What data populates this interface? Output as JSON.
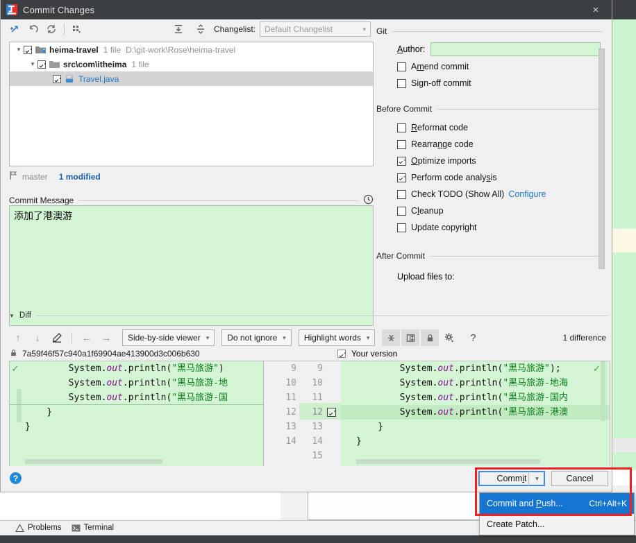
{
  "window": {
    "title": "Commit Changes",
    "app_icon": "intellij-idea-icon",
    "close_label": "×"
  },
  "changes_toolbar": {
    "buttons": [
      {
        "name": "show-diff-icon",
        "glyph": "↗"
      },
      {
        "name": "revert-icon",
        "glyph": "↺"
      },
      {
        "name": "refresh-icon",
        "glyph": "⟳"
      },
      {
        "name": "group-by-icon",
        "glyph": "∷"
      },
      {
        "name": "expand-all-icon",
        "glyph": "⤓"
      },
      {
        "name": "collapse-all-icon",
        "glyph": "⤒"
      }
    ],
    "changelist_label": "Changelist:",
    "changelist_mnemonic": "t",
    "changelist_value": "Default Changelist"
  },
  "tree": {
    "nodes": [
      {
        "label": "heima-travel",
        "meta": "1 file",
        "path": "D:\\git-work\\Rose\\heima-travel",
        "checked": true,
        "expanded": true,
        "icon": "module-folder-icon",
        "depth": 0,
        "selected": false,
        "type": "folder"
      },
      {
        "label": "src\\com\\itheima",
        "meta": "1 file",
        "path": "",
        "checked": true,
        "expanded": true,
        "icon": "folder-icon",
        "depth": 1,
        "selected": false,
        "type": "folder"
      },
      {
        "label": "Travel.java",
        "meta": "",
        "path": "",
        "checked": true,
        "expanded": null,
        "icon": "java-file-icon",
        "depth": 2,
        "selected": true,
        "type": "file"
      }
    ]
  },
  "branch_bar": {
    "icon": "branch-icon",
    "branch": "master",
    "modified": "1 modified"
  },
  "commit_message": {
    "title": "Commit Message",
    "title_mnemonic": "C",
    "history_icon": "clock-icon",
    "value": "添加了港澳游"
  },
  "git_panel": {
    "group_git": "Git",
    "author_label": "Author:",
    "author_mnemonic": "A",
    "author_value": "",
    "amend": {
      "label": "Amend commit",
      "mnemonic": "m",
      "checked": false
    },
    "signoff": {
      "label": "Sign-off commit",
      "mnemonic": "g",
      "checked": false
    },
    "group_before": "Before Commit",
    "before_items": [
      {
        "label": "Reformat code",
        "mnemonic": "R",
        "checked": false,
        "link": ""
      },
      {
        "label": "Rearrange code",
        "mnemonic": "n",
        "checked": false,
        "link": ""
      },
      {
        "label": "Optimize imports",
        "mnemonic": "O",
        "checked": true,
        "link": ""
      },
      {
        "label": "Perform code analysis",
        "mnemonic": "s",
        "checked": true,
        "link": ""
      },
      {
        "label": "Check TODO (Show All)",
        "mnemonic": "",
        "checked": false,
        "link": "Configure"
      },
      {
        "label": "Cleanup",
        "mnemonic": "l",
        "checked": false,
        "link": ""
      },
      {
        "label": "Update copyright",
        "mnemonic": "",
        "checked": false,
        "link": ""
      }
    ],
    "group_after": "After Commit",
    "upload_label": "Upload files to:"
  },
  "diff": {
    "section_title": "Diff",
    "nav_icons": [
      {
        "name": "previous-difference-icon",
        "glyph": "↑"
      },
      {
        "name": "next-difference-icon",
        "glyph": "↓"
      },
      {
        "name": "edit-source-icon",
        "glyph": "✎"
      },
      {
        "name": "previous-file-icon",
        "glyph": "←"
      },
      {
        "name": "next-file-icon",
        "glyph": "→"
      }
    ],
    "viewer_mode": "Side-by-side viewer",
    "ignore_mode": "Do not ignore",
    "highlight_mode": "Highlight words",
    "toggle_icons": [
      {
        "name": "collapse-unchanged-icon",
        "glyph": "⤓"
      },
      {
        "name": "synchronize-scroll-icon",
        "glyph": "↕"
      },
      {
        "name": "read-only-lock-icon",
        "glyph": "🔒"
      },
      {
        "name": "settings-gear-icon",
        "glyph": "⚙"
      },
      {
        "name": "help-question-icon",
        "glyph": "?"
      }
    ],
    "difference_count": "1 difference",
    "left_lock_icon": "lock-icon",
    "left_revision": "7a59f46f57c940a1f69904ae413900d3c006b630",
    "right_checked": true,
    "right_label": "Your version",
    "left_lines": [
      {
        "num": "9",
        "text": "        System.out.println(\"黑马旅游\")",
        "marker": "accept-check"
      },
      {
        "num": "10",
        "text": "        System.out.println(\"黑马旅游-地",
        "marker": ""
      },
      {
        "num": "11",
        "text": "        System.out.println(\"黑马旅游-国",
        "marker": ""
      },
      {
        "num": "12",
        "text": "    }",
        "marker": ""
      },
      {
        "num": "13",
        "text": "}",
        "marker": ""
      },
      {
        "num": "14",
        "text": "",
        "marker": ""
      }
    ],
    "right_lines": [
      {
        "num": "9",
        "text": "        System.out.println(\"黑马旅游\");",
        "added": false
      },
      {
        "num": "10",
        "text": "        System.out.println(\"黑马旅游-地海",
        "added": false
      },
      {
        "num": "11",
        "text": "        System.out.println(\"黑马旅游-国内",
        "added": false
      },
      {
        "num": "12",
        "text": "        System.out.println(\"黑马旅游-港澳",
        "added": true
      },
      {
        "num": "13",
        "text": "    }",
        "added": false
      },
      {
        "num": "14",
        "text": "}",
        "added": false
      },
      {
        "num": "15",
        "text": "",
        "added": false
      }
    ]
  },
  "buttons": {
    "help": "?",
    "commit": "Commit",
    "commit_mnemonic": "i",
    "commit_dropdown_icon": "chevron-down-icon",
    "cancel": "Cancel"
  },
  "menu": {
    "items": [
      {
        "label": "Commit and Push...",
        "mnemonic": "P",
        "shortcut": "Ctrl+Alt+K",
        "highlighted": true
      },
      {
        "label": "Create Patch...",
        "mnemonic": "",
        "shortcut": "",
        "highlighted": false
      }
    ]
  },
  "statusbar": {
    "items": [
      {
        "label": "Problems",
        "icon": "warning-triangle-icon"
      },
      {
        "label": "Terminal",
        "icon": "terminal-icon"
      }
    ]
  },
  "colors": {
    "accent_blue": "#1675d1",
    "added_green": "#d4f5d4",
    "selection_gray": "#d4d4d4",
    "annotation_red": "#ef2222",
    "link_blue": "#1b78c8",
    "titlebar": "#3c3f41"
  }
}
